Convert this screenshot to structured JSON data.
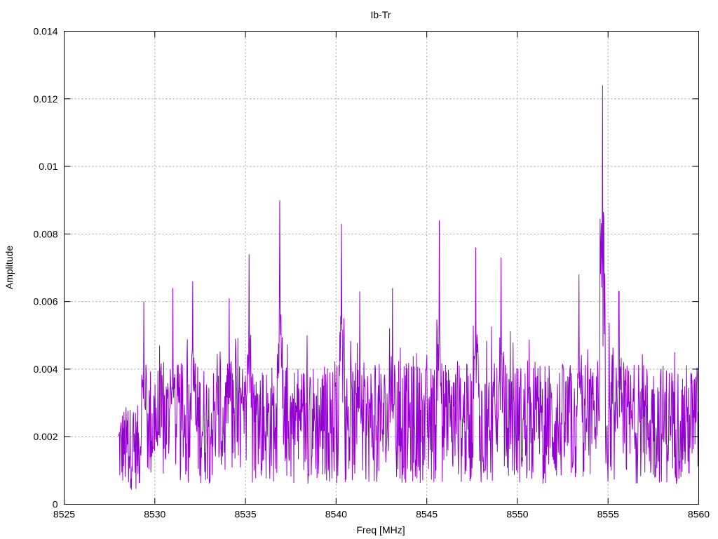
{
  "chart_data": {
    "type": "line",
    "title": "Ib-Tr",
    "xlabel": "Freq [MHz]",
    "ylabel": "Amplitude",
    "xlim": [
      8525,
      8560
    ],
    "ylim": [
      0,
      0.014
    ],
    "x_ticks": [
      "8525",
      "8530",
      "8535",
      "8540",
      "8545",
      "8550",
      "8555",
      "8560"
    ],
    "y_ticks": [
      "0",
      "0.002",
      "0.004",
      "0.006",
      "0.008",
      "0.01",
      "0.012",
      "0.014"
    ],
    "x_tick_values": [
      8525,
      8530,
      8535,
      8540,
      8545,
      8550,
      8555,
      8560
    ],
    "y_tick_values": [
      0,
      0.002,
      0.004,
      0.006,
      0.008,
      0.01,
      0.012,
      0.014
    ],
    "grid": true,
    "color": "#9400d3",
    "series": [
      {
        "name": "",
        "x_start": 8528.0,
        "x_end": 8560.0,
        "note_peaks": "dense noisy spectrum; notable peaks listed",
        "peaks": [
          [
            8529.4,
            0.006
          ],
          [
            8531.0,
            0.0064
          ],
          [
            8532.1,
            0.0066
          ],
          [
            8534.1,
            0.0061
          ],
          [
            8535.2,
            0.0074
          ],
          [
            8536.9,
            0.009
          ],
          [
            8540.3,
            0.0083
          ],
          [
            8541.3,
            0.0063
          ],
          [
            8543.1,
            0.0064
          ],
          [
            8545.7,
            0.0084
          ],
          [
            8547.7,
            0.0076
          ],
          [
            8549.1,
            0.0073
          ],
          [
            8553.4,
            0.0068
          ],
          [
            8554.7,
            0.0124
          ],
          [
            8555.6,
            0.0063
          ]
        ]
      }
    ]
  }
}
